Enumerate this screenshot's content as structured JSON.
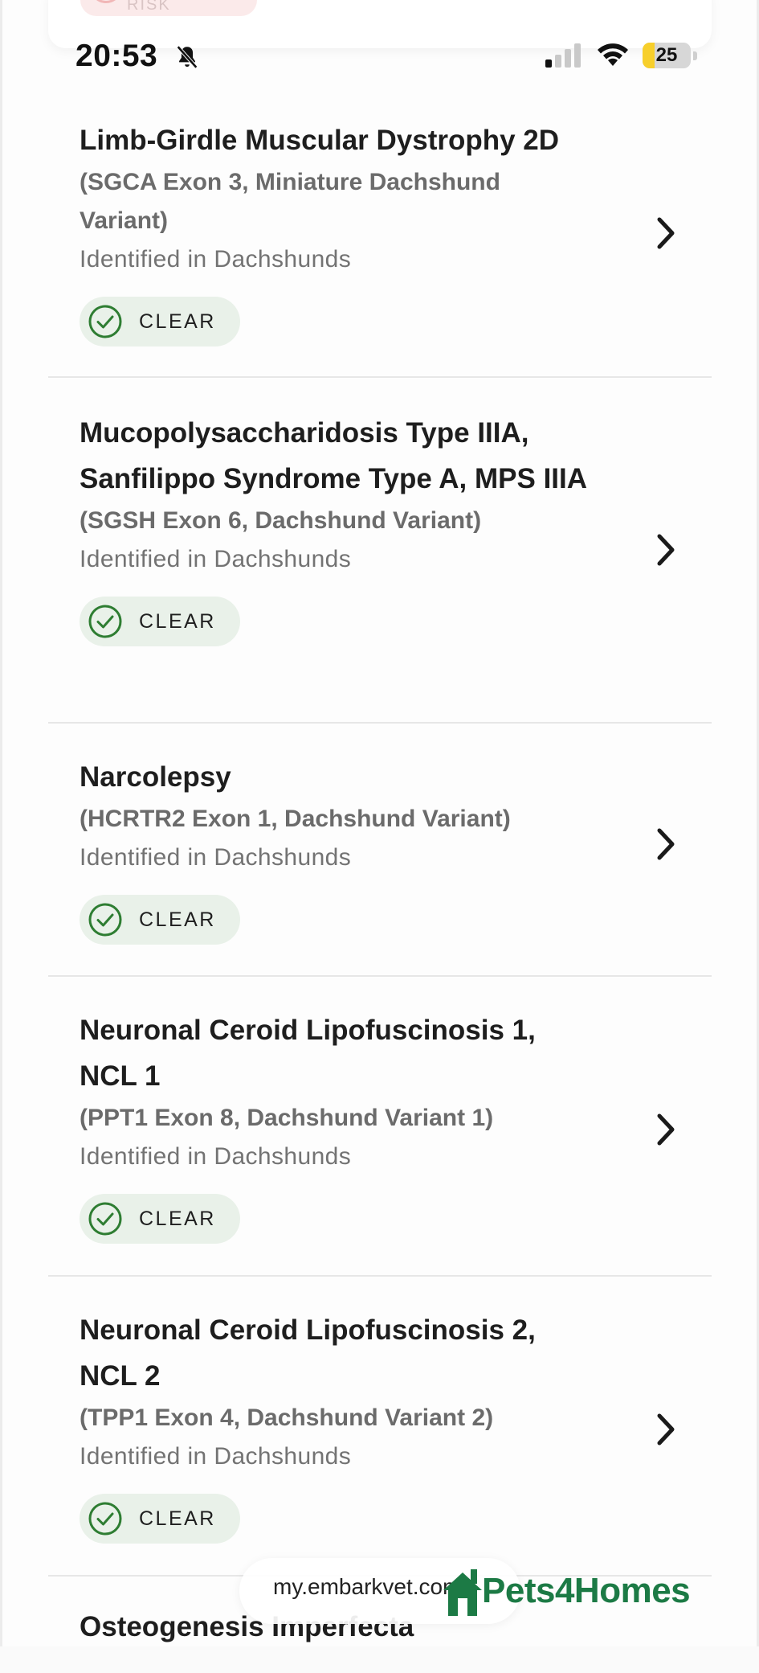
{
  "status_bar": {
    "time": "20:53",
    "battery": "25",
    "battery_level_percent": 25
  },
  "top_card": {
    "badge_text": "INCREASED RISK"
  },
  "items": [
    {
      "title": "Limb-Girdle Muscular Dystrophy 2D",
      "variant": "(SGCA Exon 3, Miniature Dachshund Variant)",
      "identified": "Identified in Dachshunds",
      "status": "CLEAR"
    },
    {
      "title": "Mucopolysaccharidosis Type IIIA, Sanfilippo Syndrome Type A, MPS IIIA",
      "variant": "(SGSH Exon 6, Dachshund Variant)",
      "identified": "Identified in Dachshunds",
      "status": "CLEAR"
    },
    {
      "title": "Narcolepsy",
      "variant": "(HCRTR2 Exon 1, Dachshund Variant)",
      "identified": "Identified in Dachshunds",
      "status": "CLEAR"
    },
    {
      "title": "Neuronal Ceroid Lipofuscinosis 1, NCL 1",
      "variant": "(PPT1 Exon 8, Dachshund Variant 1)",
      "identified": "Identified in Dachshunds",
      "status": "CLEAR"
    },
    {
      "title": "Neuronal Ceroid Lipofuscinosis 2, NCL 2",
      "variant": "(TPP1 Exon 4, Dachshund Variant 2)",
      "identified": "Identified in Dachshunds",
      "status": "CLEAR"
    },
    {
      "title": "Osteogenesis Imperfecta"
    }
  ],
  "browser": {
    "url": "my.embarkvet.com"
  },
  "watermark": {
    "text": "Pets4Homes"
  },
  "colors": {
    "clear_badge_bg": "#e9f1e9",
    "clear_icon": "#2e7d32",
    "title_text": "#1e1e1e",
    "subtitle_text": "#6b6b6b",
    "watermark_green": "#1c7a45",
    "battery_yellow": "#f7cf2b"
  },
  "icons": {
    "status": "check-circle-icon",
    "row_action": "chevron-right-icon",
    "silent": "bell-slash-icon"
  }
}
